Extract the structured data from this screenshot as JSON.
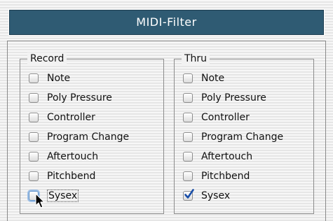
{
  "title": "MIDI-Filter",
  "record": {
    "label": "Record",
    "items": [
      {
        "label": "Note",
        "checked": false
      },
      {
        "label": "Poly Pressure",
        "checked": false
      },
      {
        "label": "Controller",
        "checked": false
      },
      {
        "label": "Program Change",
        "checked": false
      },
      {
        "label": "Aftertouch",
        "checked": false
      },
      {
        "label": "Pitchbend",
        "checked": false
      },
      {
        "label": "Sysex",
        "checked": false
      }
    ]
  },
  "thru": {
    "label": "Thru",
    "items": [
      {
        "label": "Note",
        "checked": false
      },
      {
        "label": "Poly Pressure",
        "checked": false
      },
      {
        "label": "Controller",
        "checked": false
      },
      {
        "label": "Program Change",
        "checked": false
      },
      {
        "label": "Aftertouch",
        "checked": false
      },
      {
        "label": "Pitchbend",
        "checked": false
      },
      {
        "label": "Sysex",
        "checked": true
      }
    ]
  },
  "colors": {
    "title_bar": "#2f5b73",
    "checkmark": "#1a4fa8"
  }
}
